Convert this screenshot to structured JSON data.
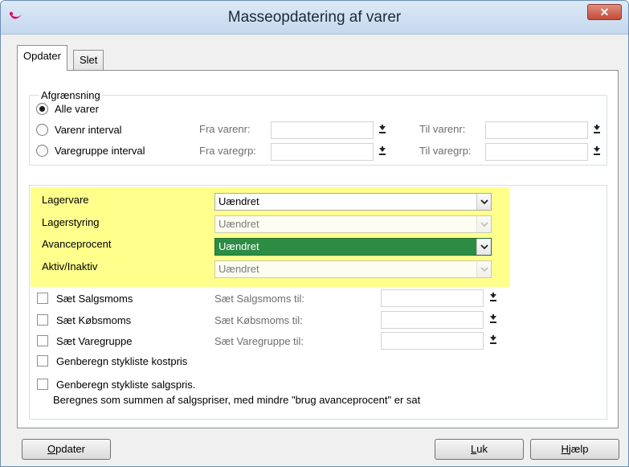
{
  "window": {
    "title": "Masseopdatering af varer",
    "close_glyph": "✕"
  },
  "tabs": [
    {
      "label": "Opdater",
      "active": true
    },
    {
      "label": "Slet",
      "active": false
    }
  ],
  "afgraensning": {
    "legend": "Afgrænsning",
    "options": [
      {
        "label": "Alle varer",
        "checked": true
      },
      {
        "label": "Varenr interval",
        "checked": false
      },
      {
        "label": "Varegruppe interval",
        "checked": false
      }
    ],
    "fra_varenr": {
      "label": "Fra varenr:",
      "value": ""
    },
    "til_varenr": {
      "label": "Til varenr:",
      "value": ""
    },
    "fra_varegrp": {
      "label": "Fra varegrp:",
      "value": ""
    },
    "til_varegrp": {
      "label": "Til varegrp:",
      "value": ""
    }
  },
  "settings": [
    {
      "label": "Lagervare",
      "value": "Uændret",
      "state": "normal"
    },
    {
      "label": "Lagerstyring",
      "value": "Uændret",
      "state": "disabled"
    },
    {
      "label": "Avanceprocent",
      "value": "Uændret",
      "state": "selected"
    },
    {
      "label": "Aktiv/Inaktiv",
      "value": "Uændret",
      "state": "disabled"
    }
  ],
  "checks": {
    "salgsmoms": {
      "label": "Sæt Salgsmoms",
      "target_label": "Sæt Salgsmoms til:",
      "checked": false
    },
    "kobsmoms": {
      "label": "Sæt Købsmoms",
      "target_label": "Sæt Købsmoms til:",
      "checked": false
    },
    "varegruppe": {
      "label": "Sæt Varegruppe",
      "target_label": "Sæt Varegruppe til:",
      "checked": false
    },
    "kostpris": {
      "label": "Genberegn stykliste kostpris",
      "checked": false
    },
    "salgspris": {
      "label": "Genberegn stykliste salgspris.",
      "checked": false,
      "note": "Beregnes som summen af salgspriser, med mindre \"brug avanceprocent\" er sat"
    }
  },
  "buttons": {
    "opdater_first": "O",
    "opdater_rest": "pdater",
    "luk_first": "L",
    "luk_rest": "uk",
    "hjaelp_first": "H",
    "hjaelp_rest": "jælp"
  },
  "colors": {
    "highlight": "#ffff8c",
    "selected": "#2c8c44"
  }
}
